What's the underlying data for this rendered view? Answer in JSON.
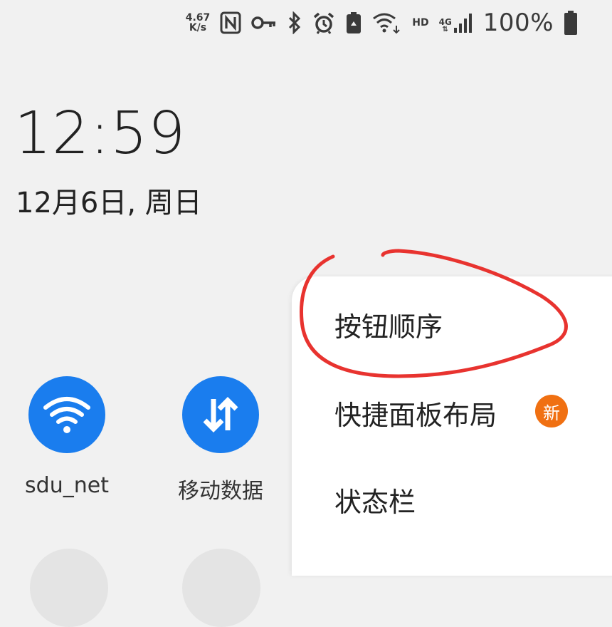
{
  "status_bar": {
    "speed_value": "4.67",
    "speed_unit": "K/s",
    "hd_label": "HD",
    "network_type": "4G",
    "network_arrows": "⇅",
    "battery_percent": "100%"
  },
  "lockscreen": {
    "time": "12:59",
    "date": "12月6日, 周日"
  },
  "quick_tiles": [
    {
      "label": "sdu_net",
      "icon": "wifi-icon",
      "color": "#1a7dee"
    },
    {
      "label": "移动数据",
      "icon": "mobile-data-icon",
      "color": "#1a7dee"
    }
  ],
  "menu": {
    "items": [
      {
        "label": "按钮顺序"
      },
      {
        "label": "快捷面板布局",
        "badge": "新"
      },
      {
        "label": "状态栏"
      }
    ],
    "badge_color": "#f07012"
  },
  "annotation": {
    "color": "#e8332f"
  }
}
